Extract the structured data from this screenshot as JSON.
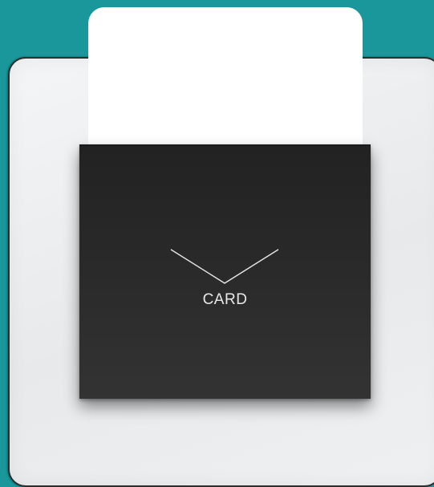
{
  "device": {
    "slot_label": "CARD",
    "colors": {
      "background": "#1a979b",
      "plate": "#eeeff0",
      "plate_border": "#2c2c2c",
      "card": "#ffffff",
      "slot": "#2a2a2a",
      "label": "#e8e8e8"
    },
    "icons": [
      "chevron-down-icon"
    ]
  }
}
